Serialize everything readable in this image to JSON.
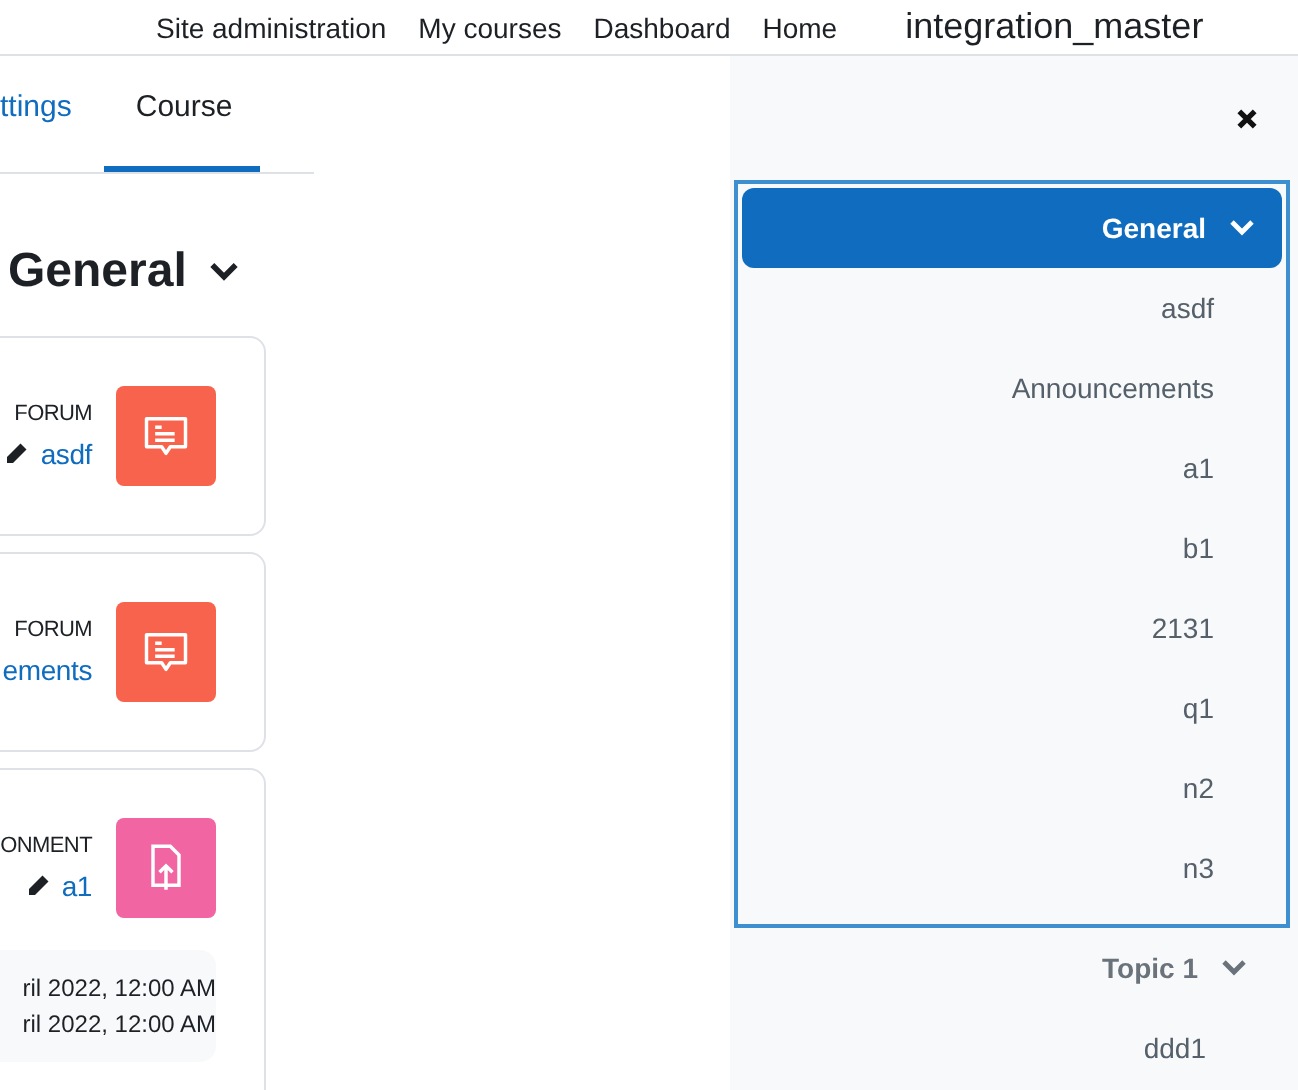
{
  "top_nav": {
    "links": [
      "Site administration",
      "My courses",
      "Dashboard",
      "Home"
    ],
    "user": "integration_master"
  },
  "tabs": [
    {
      "label": "ttings",
      "selected": false
    },
    {
      "label": "Course",
      "selected": true
    }
  ],
  "section": {
    "title": "General",
    "expanded": true
  },
  "activities": [
    {
      "kind": "forum",
      "type_label": "FORUM",
      "name": "asdf",
      "editable": true
    },
    {
      "kind": "forum",
      "type_label": "FORUM",
      "name": "ements",
      "editable": false
    },
    {
      "kind": "assignment",
      "type_label": "ONMENT",
      "name": "a1",
      "editable": true,
      "dates": [
        "ril 2022, 12:00 AM",
        "ril 2022, 12:00 AM"
      ]
    }
  ],
  "course_index": [
    {
      "title": "General",
      "selected": true,
      "expanded": true,
      "items": [
        "asdf",
        "Announcements",
        "a1",
        "b1",
        "2131",
        "q1",
        "n2",
        "n3"
      ]
    },
    {
      "title": "Topic 1",
      "selected": false,
      "expanded": true,
      "items": [
        "ddd1"
      ]
    }
  ]
}
